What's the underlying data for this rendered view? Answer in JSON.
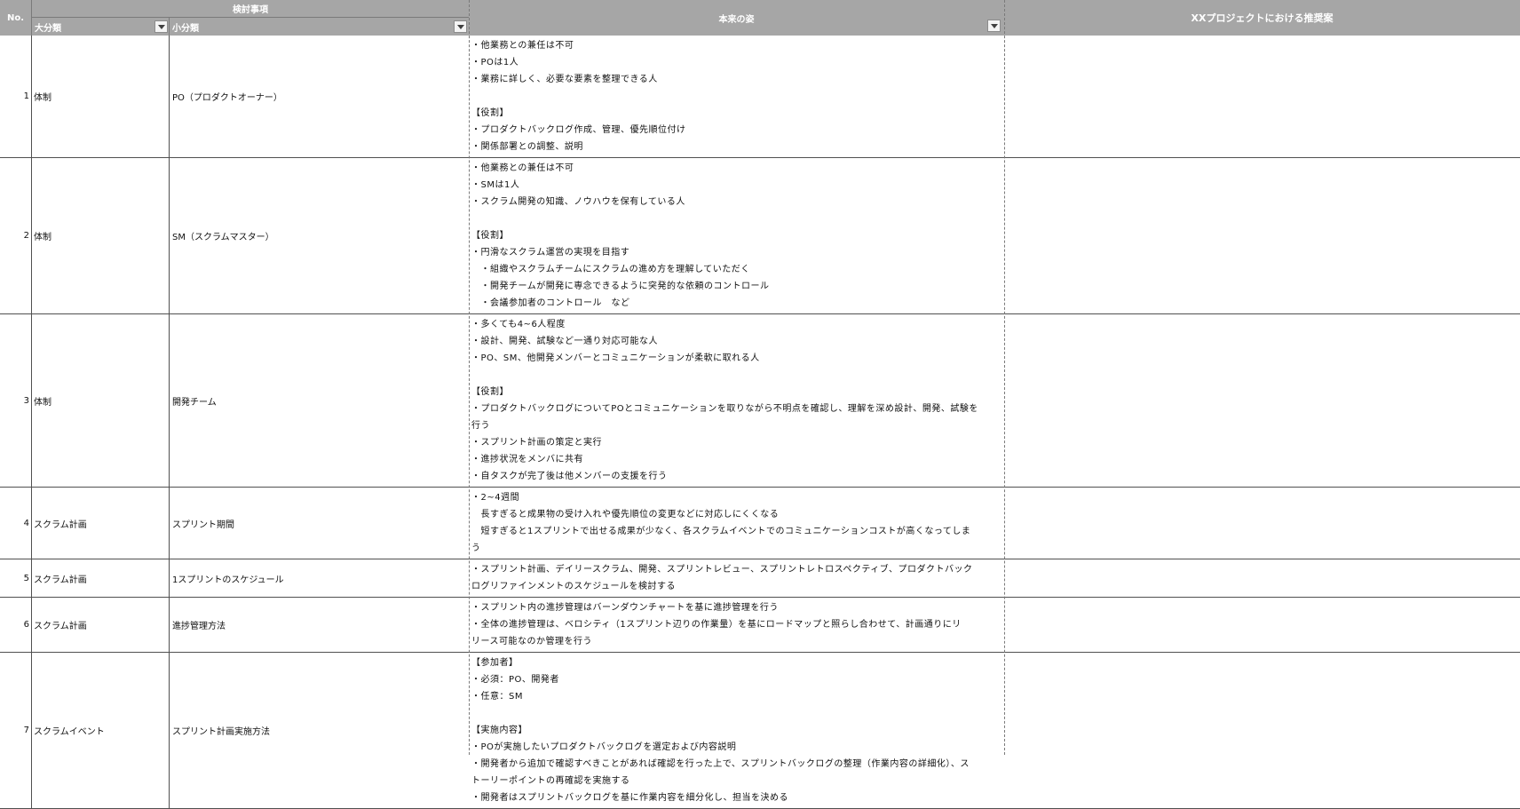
{
  "header": {
    "no": "No.",
    "kentou": "検討事項",
    "dai": "大分類",
    "sho": "小分類",
    "honrai": "本来の姿",
    "xx": "XXプロジェクトにおける推奨案",
    "filter_icon": "filter-dropdown-icon"
  },
  "rows": [
    {
      "no": "1",
      "dai": "体制",
      "sho": "PO（プロダクトオーナー）",
      "lines": [
        "・他業務との兼任は不可",
        "・POは1人",
        "・業務に詳しく、必要な要素を整理できる人",
        "",
        "【役割】",
        "・プロダクトバックログ作成、管理、優先順位付け",
        "・関係部署との調整、説明"
      ]
    },
    {
      "no": "2",
      "dai": "体制",
      "sho": "SM（スクラムマスター）",
      "lines": [
        "・他業務との兼任は不可",
        "・SMは1人",
        "・スクラム開発の知識、ノウハウを保有している人",
        "",
        "【役割】",
        "・円滑なスクラム運営の実現を目指す",
        "　・組織やスクラムチームにスクラムの進め方を理解していただく",
        "　・開発チームが開発に専念できるように突発的な依頼のコントロール",
        "　・会議参加者のコントロール　など"
      ]
    },
    {
      "no": "3",
      "dai": "体制",
      "sho": "開発チーム",
      "lines": [
        "・多くても4~6人程度",
        "・設計、開発、試験など一通り対応可能な人",
        "・PO、SM、他開発メンバーとコミュニケーションが柔軟に取れる人",
        "",
        "【役割】",
        "・プロダクトバックログについてPOとコミュニケーションを取りながら不明点を確認し、理解を深め設計、開発、試験を",
        "行う",
        "・スプリント計画の策定と実行",
        "・進捗状況をメンバに共有",
        "・自タスクが完了後は他メンバーの支援を行う"
      ]
    },
    {
      "no": "4",
      "dai": "スクラム計画",
      "sho": "スプリント期間",
      "lines": [
        "・2~4週間",
        "　長すぎると成果物の受け入れや優先順位の変更などに対応しにくくなる",
        "　短すぎると1スプリントで出せる成果が少なく、各スクラムイベントでのコミュニケーションコストが高くなってしま",
        "う"
      ]
    },
    {
      "no": "5",
      "dai": "スクラム計画",
      "sho": "1スプリントのスケジュール",
      "lines": [
        "・スプリント計画、デイリースクラム、開発、スプリントレビュー、スプリントレトロスペクティブ、プロダクトバック",
        "ログリファインメントのスケジュールを検討する"
      ]
    },
    {
      "no": "6",
      "dai": "スクラム計画",
      "sho": "進捗管理方法",
      "lines": [
        "・スプリント内の進捗管理はバーンダウンチャートを基に進捗管理を行う",
        "・全体の進捗管理は、ベロシティ（1スプリント辺りの作業量）を基にロードマップと照らし合わせて、計画通りにリ",
        "リース可能なのか管理を行う"
      ]
    },
    {
      "no": "7",
      "dai": "スクラムイベント",
      "sho": "スプリント計画実施方法",
      "lines": [
        "【参加者】",
        "・必須：PO、開発者",
        "・任意：SM",
        "",
        "【実施内容】",
        "・POが実施したいプロダクトバックログを選定および内容説明",
        "・開発者から追加で確認すべきことがあれば確認を行った上で、スプリントバックログの整理（作業内容の詳細化）、ス",
        "トーリーポイントの再確認を実施する",
        "・開発者はスプリントバックログを基に作業内容を細分化し、担当を決める"
      ]
    }
  ]
}
